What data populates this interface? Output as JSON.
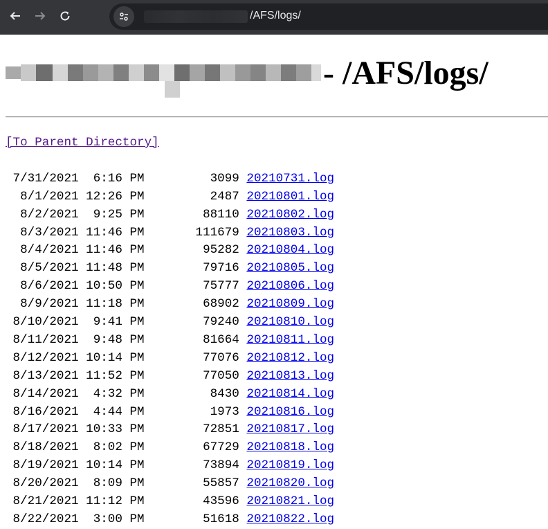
{
  "browser": {
    "url_path": "/AFS/logs/",
    "back_icon": "arrow-left-icon",
    "forward_icon": "arrow-right-icon",
    "reload_icon": "reload-icon",
    "site_info_icon": "tune-icon"
  },
  "page": {
    "heading_suffix": "- /AFS/logs/",
    "parent_link": "[To Parent Directory]",
    "rows": [
      {
        "date": "7/31/2021",
        "time": "6:16 PM",
        "size": "3099",
        "name": "20210731.log"
      },
      {
        "date": "8/1/2021",
        "time": "12:26 PM",
        "size": "2487",
        "name": "20210801.log"
      },
      {
        "date": "8/2/2021",
        "time": "9:25 PM",
        "size": "88110",
        "name": "20210802.log"
      },
      {
        "date": "8/3/2021",
        "time": "11:46 PM",
        "size": "111679",
        "name": "20210803.log"
      },
      {
        "date": "8/4/2021",
        "time": "11:46 PM",
        "size": "95282",
        "name": "20210804.log"
      },
      {
        "date": "8/5/2021",
        "time": "11:48 PM",
        "size": "79716",
        "name": "20210805.log"
      },
      {
        "date": "8/6/2021",
        "time": "10:50 PM",
        "size": "75777",
        "name": "20210806.log"
      },
      {
        "date": "8/9/2021",
        "time": "11:18 PM",
        "size": "68902",
        "name": "20210809.log"
      },
      {
        "date": "8/10/2021",
        "time": "9:41 PM",
        "size": "79240",
        "name": "20210810.log"
      },
      {
        "date": "8/11/2021",
        "time": "9:48 PM",
        "size": "81664",
        "name": "20210811.log"
      },
      {
        "date": "8/12/2021",
        "time": "10:14 PM",
        "size": "77076",
        "name": "20210812.log"
      },
      {
        "date": "8/13/2021",
        "time": "11:52 PM",
        "size": "77050",
        "name": "20210813.log"
      },
      {
        "date": "8/14/2021",
        "time": "4:32 PM",
        "size": "8430",
        "name": "20210814.log"
      },
      {
        "date": "8/16/2021",
        "time": "4:44 PM",
        "size": "1973",
        "name": "20210816.log"
      },
      {
        "date": "8/17/2021",
        "time": "10:33 PM",
        "size": "72851",
        "name": "20210817.log"
      },
      {
        "date": "8/18/2021",
        "time": "8:02 PM",
        "size": "67729",
        "name": "20210818.log"
      },
      {
        "date": "8/19/2021",
        "time": "10:14 PM",
        "size": "73894",
        "name": "20210819.log"
      },
      {
        "date": "8/20/2021",
        "time": "8:09 PM",
        "size": "55857",
        "name": "20210820.log"
      },
      {
        "date": "8/21/2021",
        "time": "11:12 PM",
        "size": "43596",
        "name": "20210821.log"
      },
      {
        "date": "8/22/2021",
        "time": "3:00 PM",
        "size": "51618",
        "name": "20210822.log"
      }
    ]
  },
  "colors": {
    "toolbar_bg": "#35363a",
    "omnibox_bg": "#202124",
    "link": "#0000ee",
    "visited_link": "#551a8b"
  }
}
